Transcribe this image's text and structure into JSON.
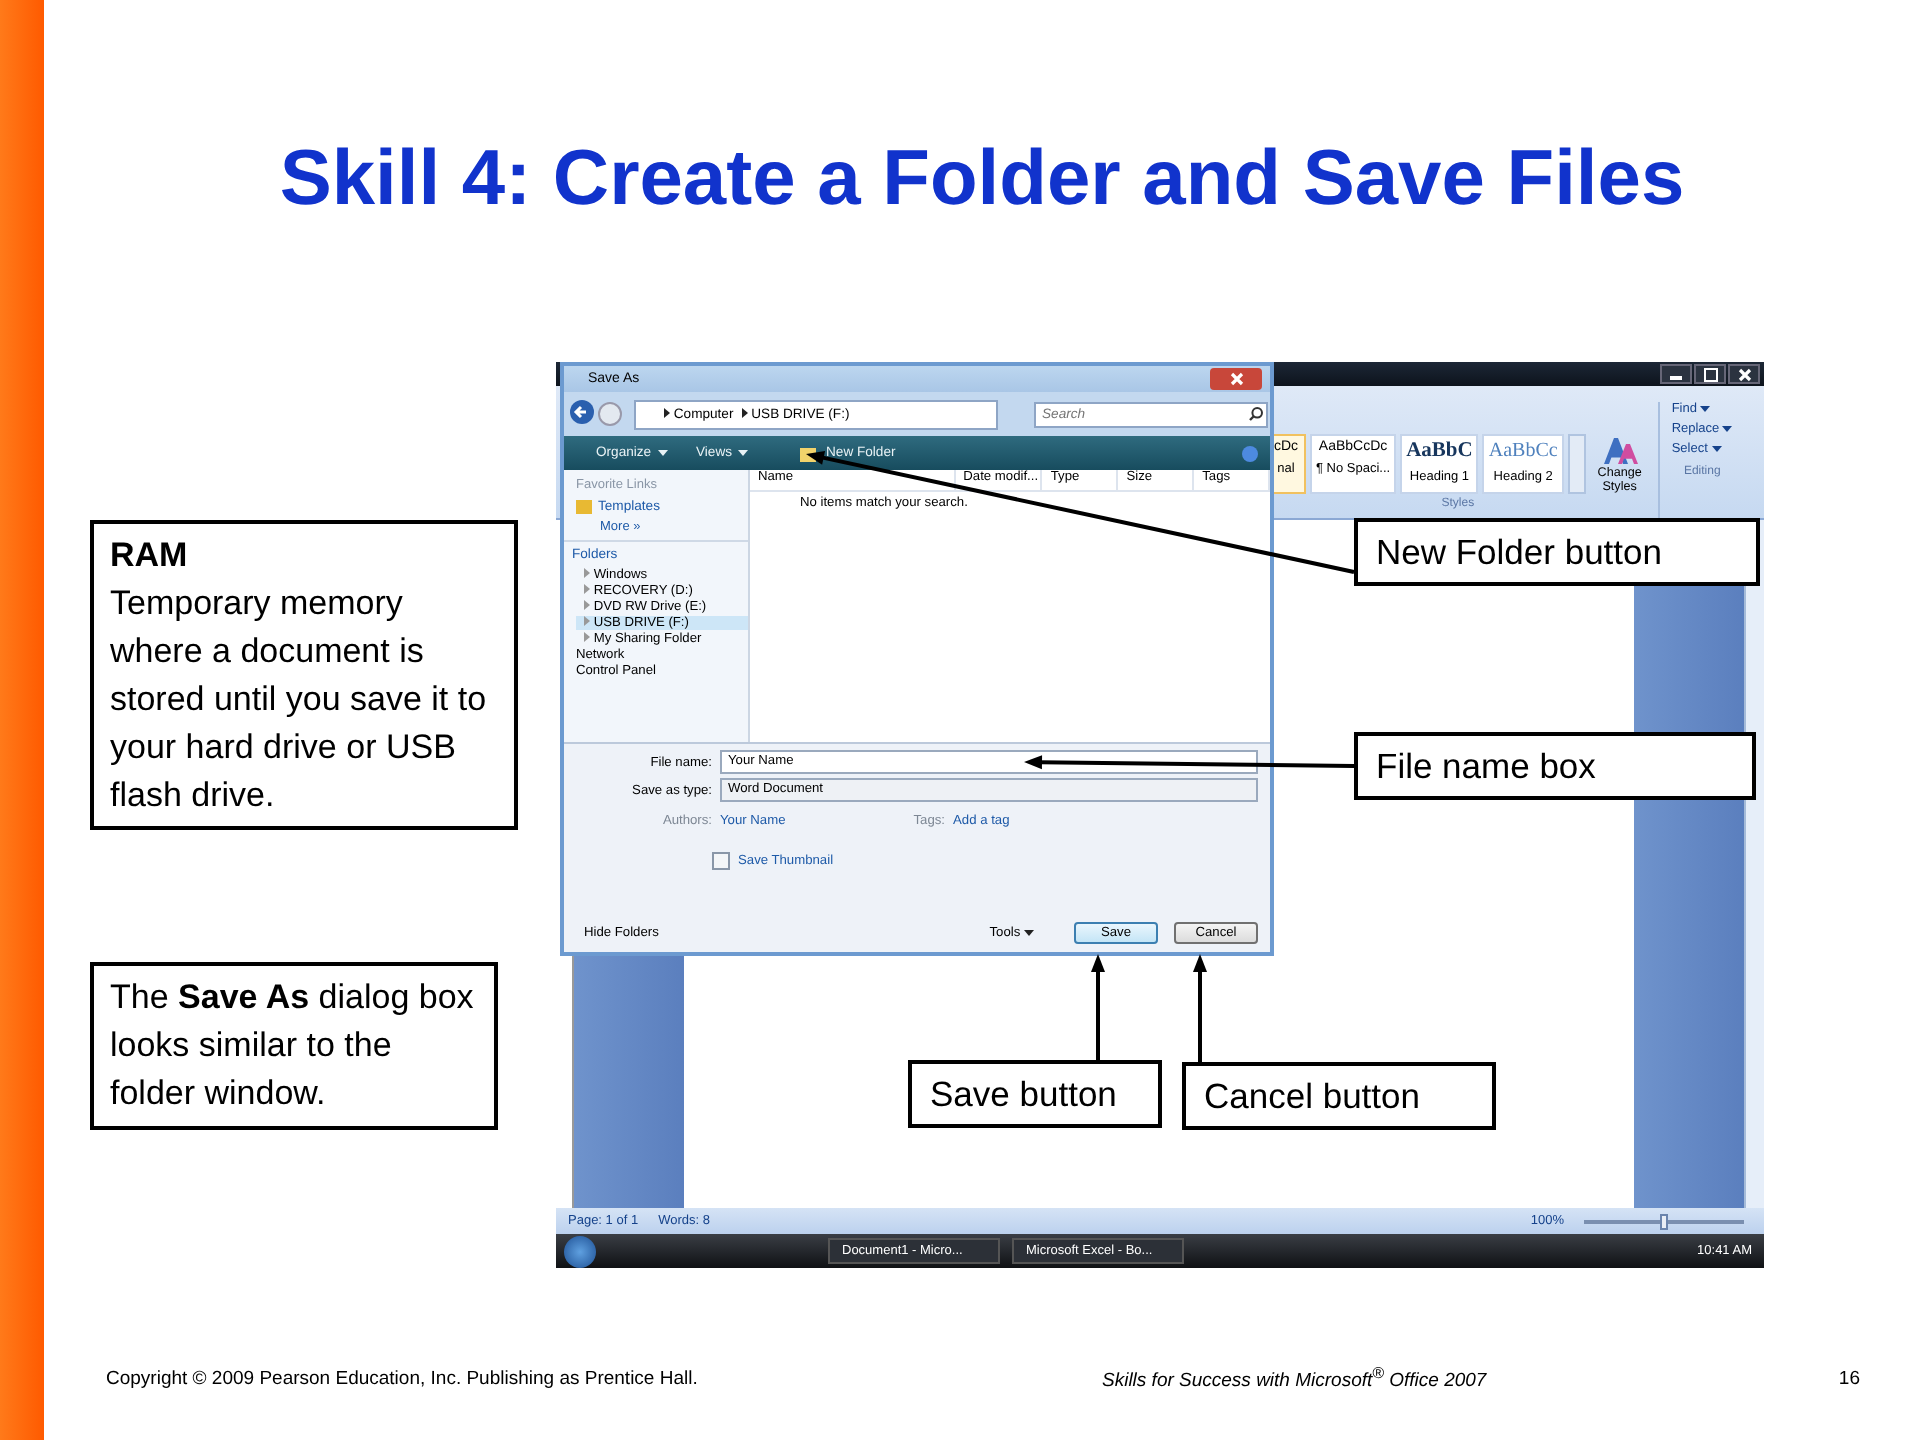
{
  "slide": {
    "title": "Skill 4: Create a Folder and Save Files"
  },
  "notes": [
    {
      "heading": "RAM",
      "text": "Temporary memory where a document is stored until you save it to your hard drive or USB flash drive."
    },
    {
      "text": "The **Save As** dialog box looks similar to the folder window."
    }
  ],
  "word_window": {
    "styles": [
      {
        "preview": "cDc",
        "label": "nal",
        "selected": true
      },
      {
        "preview": "AaBbCcDc",
        "label": "¶ No Spaci...",
        "selected": false
      },
      {
        "preview": "AaBbC",
        "label": "Heading 1",
        "selected": false
      },
      {
        "preview": "AaBbCc",
        "label": "Heading 2",
        "selected": false
      }
    ],
    "change_styles": "Change Styles",
    "editing": [
      "Find",
      "Replace",
      "Select"
    ],
    "groups": [
      "Styles",
      "Editing"
    ],
    "status_bar": {
      "page": "Page: 1 of 1",
      "words": "Words: 8",
      "zoom": "100%",
      "zoom_slider": {
        "level": 0.5
      }
    },
    "taskbar": {
      "windows": [
        "Document1 - Micro...",
        "Microsoft Excel - Bo..."
      ],
      "time": "10:41 AM"
    }
  },
  "dialog": {
    "title": "Save As",
    "path": [
      "Computer",
      "USB DRIVE (F:)"
    ],
    "search": {
      "placeholder": "Search"
    },
    "toolbar": [
      "Organize",
      "Views",
      "New Folder"
    ],
    "favorite_links": {
      "heading": "Favorite Links",
      "items": [
        "Templates"
      ],
      "more": "More »"
    },
    "folders": {
      "heading": "Folders",
      "drives": [
        {
          "label": "Windows",
          "selected": false
        },
        {
          "label": "RECOVERY (D:)",
          "selected": false
        },
        {
          "label": "DVD RW Drive (E:)",
          "selected": false
        },
        {
          "label": "USB DRIVE (F:)",
          "selected": true
        },
        {
          "label": "My Sharing Folder",
          "selected": false
        }
      ],
      "places": [
        "Network",
        "Control Panel"
      ]
    },
    "columns": [
      "Name",
      "Date modif...",
      "Type",
      "Size",
      "Tags"
    ],
    "empty_message": "No items match your search.",
    "file_name": {
      "label": "File name:",
      "value": "Your Name"
    },
    "save_as_type": {
      "label": "Save as type:",
      "value": "Word Document"
    },
    "authors": {
      "label": "Authors:",
      "value": "Your Name"
    },
    "tags": {
      "label": "Tags:",
      "value": "Add a tag"
    },
    "save_thumbnail": {
      "label": "Save Thumbnail",
      "checked": false
    },
    "hide_folders": "Hide Folders",
    "tools": "Tools",
    "buttons": [
      "Save",
      "Cancel"
    ]
  },
  "callouts": [
    {
      "text": "New Folder button"
    },
    {
      "text": "File name box"
    },
    {
      "text": "Save button"
    },
    {
      "text": "Cancel button"
    }
  ],
  "footer": {
    "copyright": "Copyright © 2009 Pearson Education, Inc. Publishing as Prentice Hall.",
    "book": "Skills for Success with Microsoft$^{®}$ Office 2007",
    "page": "16"
  }
}
